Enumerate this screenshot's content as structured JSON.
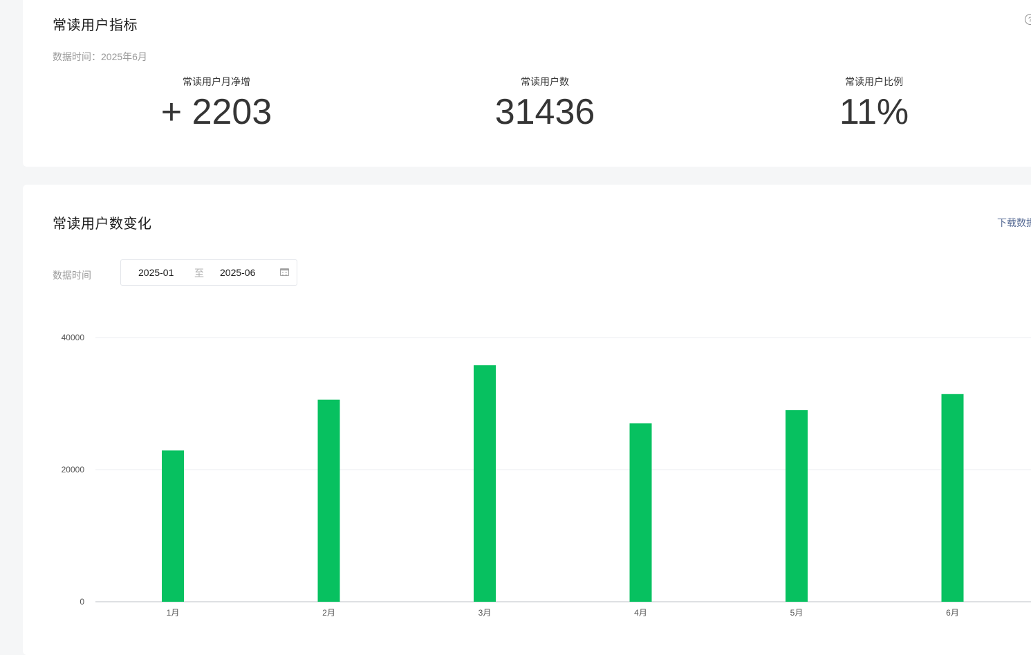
{
  "metrics_card": {
    "title": "常读用户指标",
    "help_icon": "?",
    "data_time": "数据时间：2025年6月",
    "metrics": [
      {
        "label": "常读用户月净增",
        "value": "+ 2203"
      },
      {
        "label": "常读用户数",
        "value": "31436"
      },
      {
        "label": "常读用户比例",
        "value": "11%"
      }
    ]
  },
  "chart_card": {
    "title": "常读用户数变化",
    "download_label": "下载数据",
    "range_label": "数据时间",
    "range_start": "2025-01",
    "range_separator": "至",
    "range_end": "2025-06"
  },
  "chart_data": {
    "type": "bar",
    "categories": [
      "1月",
      "2月",
      "3月",
      "4月",
      "5月",
      "6月"
    ],
    "values": [
      22900,
      30600,
      35800,
      27000,
      29000,
      31436
    ],
    "ylim": [
      0,
      40000
    ],
    "yticks": [
      0,
      20000,
      40000
    ],
    "grid": true,
    "bar_color": "#07c160"
  }
}
